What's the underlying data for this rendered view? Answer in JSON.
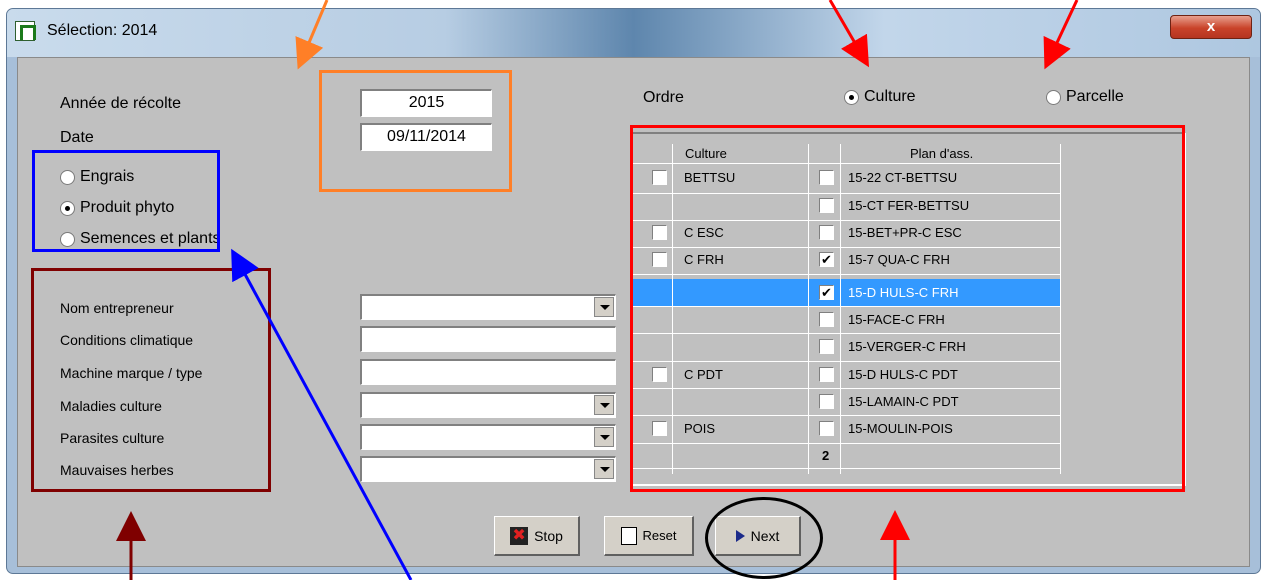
{
  "window": {
    "title": "Sélection: 2014",
    "close_label": "x"
  },
  "harvest": {
    "label": "Année de récolte",
    "value": "2015"
  },
  "date": {
    "label": "Date",
    "value": "09/11/2014"
  },
  "type_options": [
    {
      "label": "Engrais",
      "selected": false
    },
    {
      "label": "Produit phyto",
      "selected": true
    },
    {
      "label": "Semences et plants",
      "selected": false
    }
  ],
  "form": {
    "fields": [
      {
        "label": "Nom entrepreneur",
        "value": "",
        "kind": "dropdown"
      },
      {
        "label": "Conditions climatique",
        "value": "",
        "kind": "text"
      },
      {
        "label": "Machine marque / type",
        "value": "",
        "kind": "text"
      },
      {
        "label": "Maladies culture",
        "value": "",
        "kind": "dropdown"
      },
      {
        "label": "Parasites culture",
        "value": "",
        "kind": "dropdown"
      },
      {
        "label": "Mauvaises herbes",
        "value": "",
        "kind": "dropdown"
      }
    ]
  },
  "order": {
    "label": "Ordre",
    "options": [
      {
        "label": "Culture",
        "selected": true
      },
      {
        "label": "Parcelle",
        "selected": false
      }
    ]
  },
  "grid": {
    "headers": {
      "culture": "Culture",
      "plan": "Plan d'ass."
    },
    "rows": [
      {
        "culture": "BETTSU",
        "culture_cb": true,
        "plan": "15-22 CT-BETTSU",
        "plan_checked": false,
        "selected": false
      },
      {
        "culture": "",
        "culture_cb": false,
        "plan": "15-CT FER-BETTSU",
        "plan_checked": false,
        "selected": false
      },
      {
        "culture": "C ESC",
        "culture_cb": true,
        "plan": "15-BET+PR-C ESC",
        "plan_checked": false,
        "selected": false
      },
      {
        "culture": "C FRH",
        "culture_cb": true,
        "plan": "15-7 QUA-C FRH",
        "plan_checked": true,
        "selected": false
      },
      {
        "culture": "",
        "culture_cb": false,
        "plan": "15-D HULS-C FRH",
        "plan_checked": true,
        "selected": true
      },
      {
        "culture": "",
        "culture_cb": false,
        "plan": "15-FACE-C FRH",
        "plan_checked": false,
        "selected": false
      },
      {
        "culture": "",
        "culture_cb": false,
        "plan": "15-VERGER-C FRH",
        "plan_checked": false,
        "selected": false
      },
      {
        "culture": "C PDT",
        "culture_cb": true,
        "plan": "15-D HULS-C PDT",
        "plan_checked": false,
        "selected": false
      },
      {
        "culture": "",
        "culture_cb": false,
        "plan": "15-LAMAIN-C PDT",
        "plan_checked": false,
        "selected": false
      },
      {
        "culture": "POIS",
        "culture_cb": true,
        "plan": "15-MOULIN-POIS",
        "plan_checked": false,
        "selected": false
      }
    ],
    "footer_count": "2"
  },
  "buttons": {
    "stop": "Stop",
    "reset": "Reset",
    "next": "Next"
  },
  "colors": {
    "annotation_orange": "#ff7f27",
    "annotation_red": "#ff0000",
    "annotation_blue": "#0000ff",
    "annotation_darkred": "#7f0000",
    "annotation_black": "#000000",
    "selection": "#3399ff"
  },
  "icons": {
    "app": "app-icon",
    "stop": "stop-icon",
    "reset": "reset-icon",
    "next": "next-arrow-icon"
  }
}
